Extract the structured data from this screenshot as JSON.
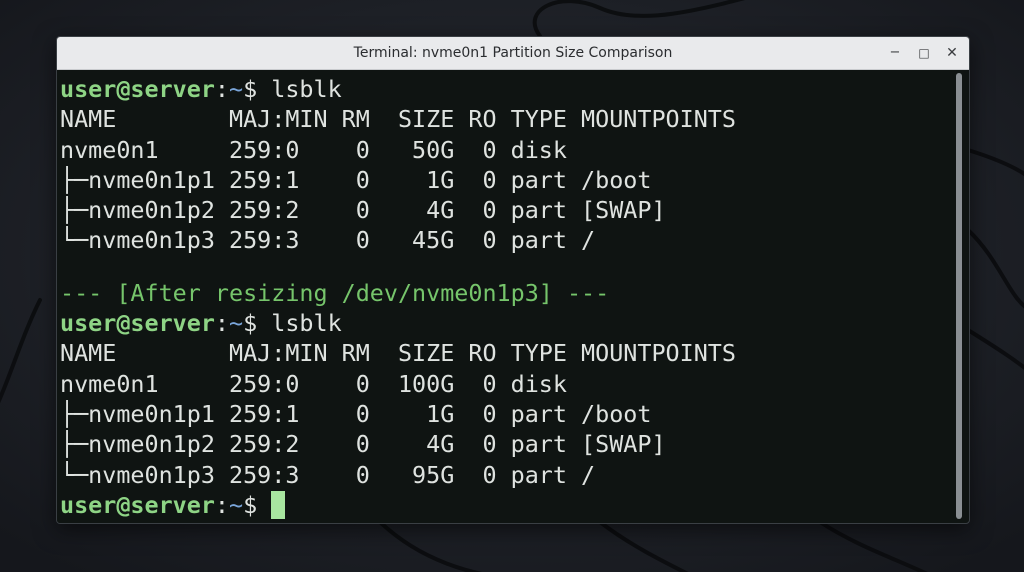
{
  "window": {
    "title": "Terminal: nvme0n1 Partition Size Comparison",
    "controls": {
      "minimize_glyph": "−",
      "maximize_glyph": "□",
      "close_glyph": "✕"
    }
  },
  "terminal": {
    "prompt": {
      "user_host": "user@server",
      "colon": ":",
      "path": "~",
      "symbol": "$ "
    },
    "before": {
      "command": "lsblk",
      "header": "NAME        MAJ:MIN RM  SIZE RO TYPE MOUNTPOINTS",
      "rows": [
        "nvme0n1     259:0    0   50G  0 disk",
        "├─nvme0n1p1 259:1    0    1G  0 part /boot",
        "├─nvme0n1p2 259:2    0    4G  0 part [SWAP]",
        "└─nvme0n1p3 259:3    0   45G  0 part /"
      ]
    },
    "separator": "--- [After resizing /dev/nvme0n1p3] ---",
    "after": {
      "command": "lsblk",
      "header": "NAME        MAJ:MIN RM  SIZE RO TYPE MOUNTPOINTS",
      "rows": [
        "nvme0n1     259:0    0  100G  0 disk",
        "├─nvme0n1p1 259:1    0    1G  0 part /boot",
        "├─nvme0n1p2 259:2    0    4G  0 part [SWAP]",
        "└─nvme0n1p3 259:3    0   95G  0 part /"
      ]
    }
  },
  "colors": {
    "prompt_user": "#8ed485",
    "prompt_path": "#7aa6da",
    "separator": "#76c56b",
    "text": "#dfe3e0",
    "cursor": "#a8e6a0",
    "terminal_bg": "#0f1412",
    "titlebar_bg": "#e9eaec"
  }
}
